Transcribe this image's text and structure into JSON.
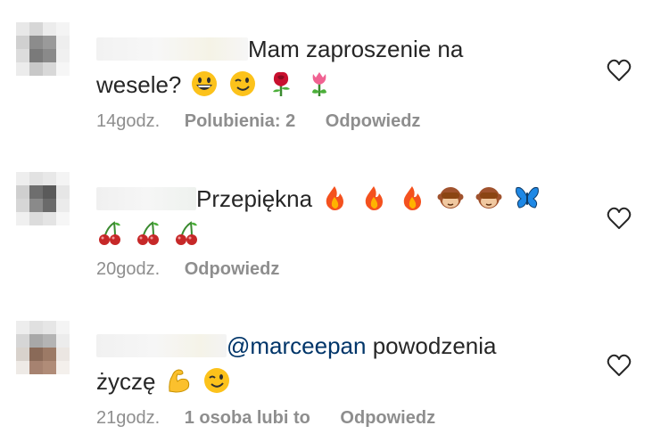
{
  "comments": [
    {
      "text_before": "",
      "text_line1": "Mam zaproszenie na",
      "text_line2": "wesele?",
      "emojis_line2": [
        "grinning-face-emoji",
        "winking-face-emoji",
        "rose-emoji",
        "tulip-emoji"
      ],
      "time": "14godz.",
      "likes": "Polubienia: 2",
      "reply": "Odpowiedz"
    },
    {
      "text_line1": "Przepiękna",
      "emojis_line1": [
        "fire-emoji",
        "fire-emoji",
        "fire-emoji",
        "see-no-evil-monkey-emoji",
        "see-no-evil-monkey-emoji",
        "butterfly-emoji"
      ],
      "emojis_line2": [
        "cherries-emoji",
        "cherries-emoji",
        "cherries-emoji"
      ],
      "time": "20godz.",
      "reply": "Odpowiedz"
    },
    {
      "mention": "@marceepan",
      "text_line1": " powodzenia",
      "text_line2": "życzę",
      "emojis_line2": [
        "flexed-biceps-emoji",
        "winking-face-emoji"
      ],
      "time": "21godz.",
      "likes": "1 osoba lubi to",
      "reply": "Odpowiedz"
    }
  ],
  "colors": {
    "text": "#262626",
    "meta": "#8e8e8e",
    "mention": "#003569"
  }
}
